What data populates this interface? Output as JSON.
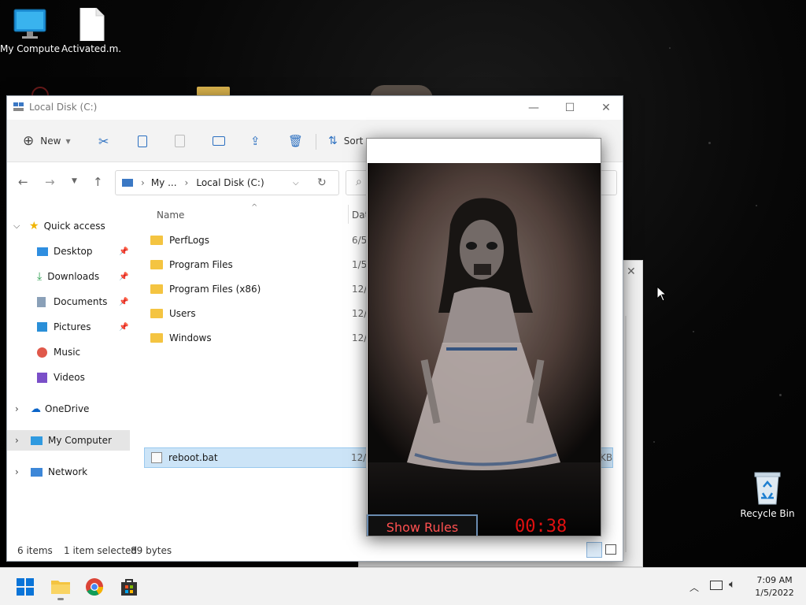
{
  "desktop": {
    "icons": [
      {
        "label": "My Computer",
        "icon": "monitor-icon"
      },
      {
        "label": "Activated.m...",
        "icon": "file-icon"
      },
      {
        "label": "Recycle Bin",
        "icon": "recycle-bin-icon"
      }
    ]
  },
  "explorer": {
    "title": "Local Disk (C:)",
    "toolbar": {
      "new_label": "New",
      "sort_label": "Sort"
    },
    "breadcrumb": {
      "root": "My ...",
      "current": "Local Disk (C:)"
    },
    "columns": {
      "name": "Name",
      "date": "Date"
    },
    "nav": {
      "quick_access": "Quick access",
      "items": [
        "Desktop",
        "Downloads",
        "Documents",
        "Pictures",
        "Music",
        "Videos"
      ],
      "onedrive": "OneDrive",
      "my_computer": "My Computer",
      "network": "Network"
    },
    "files": [
      {
        "name": "PerfLogs",
        "date": "6/5/"
      },
      {
        "name": "Program Files",
        "date": "1/5/"
      },
      {
        "name": "Program Files (x86)",
        "date": "12/2"
      },
      {
        "name": "Users",
        "date": "12/2"
      },
      {
        "name": "Windows",
        "date": "12/2"
      },
      {
        "name": "reboot.bat",
        "date": "12/2",
        "size_suffix": "KB"
      }
    ],
    "status": {
      "count": "6 items",
      "selected": "1 item selected",
      "size": "89 bytes"
    }
  },
  "popup": {
    "rules_label": "Show Rules",
    "timer": "00:38"
  },
  "taskbar": {
    "time": "7:09 AM",
    "date": "1/5/2022"
  },
  "colors": {
    "accent": "#0078d4",
    "timer": "#e01010",
    "rules_text": "#ff5050"
  }
}
